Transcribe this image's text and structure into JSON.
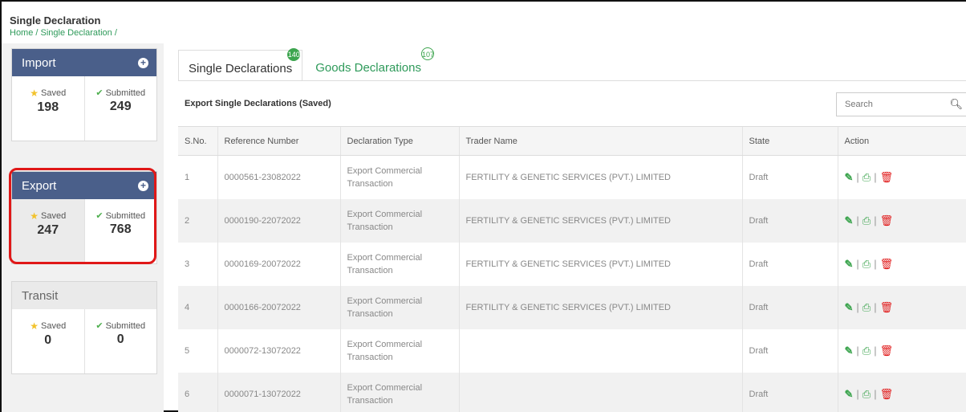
{
  "page": {
    "title": "Single Declaration",
    "breadcrumb": "Home / Single Declaration /"
  },
  "sidebar": {
    "import": {
      "title": "Import",
      "saved_label": "Saved",
      "saved_count": "198",
      "submitted_label": "Submitted",
      "submitted_count": "249"
    },
    "export": {
      "title": "Export",
      "saved_label": "Saved",
      "saved_count": "247",
      "submitted_label": "Submitted",
      "submitted_count": "768"
    },
    "transit": {
      "title": "Transit",
      "saved_label": "Saved",
      "saved_count": "0",
      "submitted_label": "Submitted",
      "submitted_count": "0"
    }
  },
  "tabs": [
    {
      "label": "Single Declarations",
      "badge": "140"
    },
    {
      "label": "Goods Declarations",
      "badge": "107"
    }
  ],
  "panel": {
    "title": "Export Single Declarations (Saved)",
    "search_placeholder": "Search"
  },
  "table": {
    "headers": [
      "S.No.",
      "Reference Number",
      "Declaration Type",
      "Trader Name",
      "State",
      "Action"
    ],
    "rows": [
      {
        "sno": "1",
        "ref": "0000561-23082022",
        "type": "Export Commercial Transaction",
        "trader": "FERTILITY & GENETIC SERVICES (PVT.) LIMITED",
        "state": "Draft"
      },
      {
        "sno": "2",
        "ref": "0000190-22072022",
        "type": "Export Commercial Transaction",
        "trader": "FERTILITY & GENETIC SERVICES (PVT.) LIMITED",
        "state": "Draft"
      },
      {
        "sno": "3",
        "ref": "0000169-20072022",
        "type": "Export Commercial Transaction",
        "trader": "FERTILITY & GENETIC SERVICES (PVT.) LIMITED",
        "state": "Draft"
      },
      {
        "sno": "4",
        "ref": "0000166-20072022",
        "type": "Export Commercial Transaction",
        "trader": "FERTILITY & GENETIC SERVICES (PVT.) LIMITED",
        "state": "Draft"
      },
      {
        "sno": "5",
        "ref": "0000072-13072022",
        "type": "Export Commercial Transaction",
        "trader": "",
        "state": "Draft"
      },
      {
        "sno": "6",
        "ref": "0000071-13072022",
        "type": "Export Commercial Transaction",
        "trader": "",
        "state": "Draft"
      }
    ],
    "action_icons": [
      "edit-icon",
      "print-icon",
      "delete-icon"
    ]
  },
  "colors": {
    "accent_green": "#3da54f",
    "header_blue": "#4a5f8a",
    "highlight_red": "#e01818"
  }
}
